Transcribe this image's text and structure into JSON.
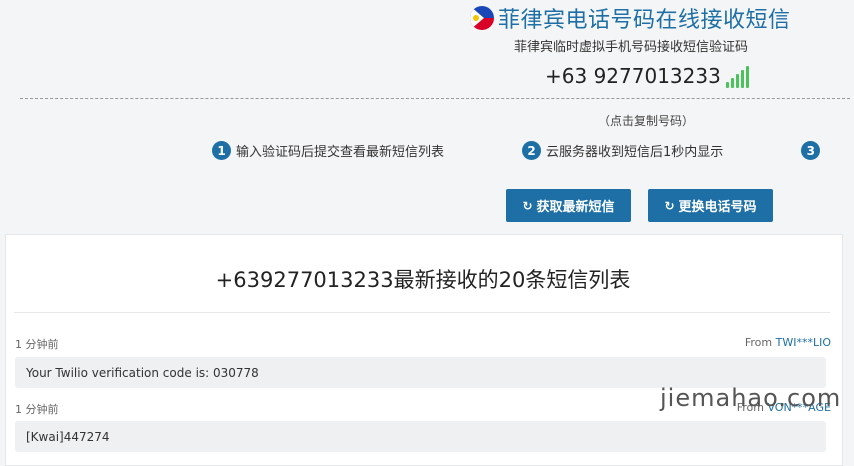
{
  "header": {
    "title": "菲律宾电话号码在线接收短信",
    "subtitle": "菲律宾临时虚拟手机号码接收短信验证码",
    "phone": "+63 9277013233",
    "flag_icon": "philippines-flag-icon",
    "signal_icon": "signal-bars-icon"
  },
  "copy_hint": "（点击复制号码）",
  "steps": [
    {
      "num": "1",
      "text": "输入验证码后提交查看最新短信列表"
    },
    {
      "num": "2",
      "text": "云服务器收到短信后1秒内显示"
    },
    {
      "num": "3",
      "text": ""
    }
  ],
  "buttons": {
    "refresh_label": "获取最新短信",
    "change_label": "更换电话号码",
    "icon": "refresh-icon"
  },
  "list": {
    "title": "+639277013233最新接收的20条短信列表",
    "messages": [
      {
        "time": "1 分钟前",
        "from_prefix": "From ",
        "from": "TWI***LIO",
        "body": "Your Twilio verification code is: 030778"
      },
      {
        "time": "1 分钟前",
        "from_prefix": "From ",
        "from": "VON***AGE",
        "body": "[Kwai]447274"
      }
    ]
  },
  "watermark": "jiemahao.com",
  "colors": {
    "accent": "#1d6fa5",
    "signal": "#4cc35a"
  }
}
